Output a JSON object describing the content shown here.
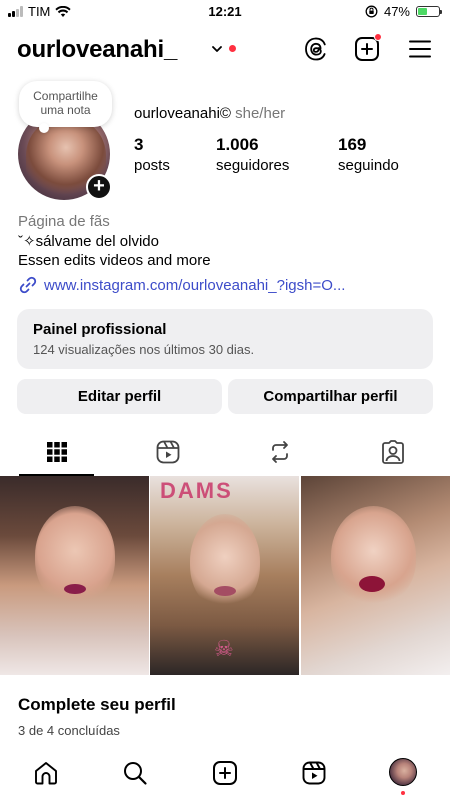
{
  "status_bar": {
    "carrier": "TIM",
    "time": "12:21",
    "battery": "47%",
    "battery_level": 0.47
  },
  "header": {
    "username": "ourloveanahi_",
    "icons": [
      "threads-icon",
      "create-plus-icon",
      "hamburger-menu-icon"
    ]
  },
  "profile": {
    "note_prompt": "Compartilhe uma nota",
    "display_name": "ourloveanahi©",
    "pronouns": "she/her",
    "stats": {
      "posts_value": "3",
      "posts_label": "posts",
      "followers_value": "1.006",
      "followers_label": "seguidores",
      "following_value": "169",
      "following_label": "seguindo"
    },
    "bio": {
      "category": "Página de fãs",
      "line1": "ˇ✧sálvame del olvido",
      "line2": "Essen edits videos and more",
      "link": "www.instagram.com/ourloveanahi_?igsh=O..."
    }
  },
  "pro_panel": {
    "title": "Painel profissional",
    "subtitle": "124 visualizações nos últimos 30 dias."
  },
  "buttons": {
    "edit": "Editar perfil",
    "share": "Compartilhar perfil"
  },
  "tabs": [
    "grid-icon",
    "reels-icon",
    "reposts-icon",
    "tagged-icon"
  ],
  "posts": {
    "post2_overlay": "DAMS"
  },
  "complete_profile": {
    "title": "Complete seu perfil",
    "progress": "3 de 4",
    "progress_suffix": "concluídas"
  },
  "bottom_nav": [
    "home-icon",
    "search-icon",
    "create-icon",
    "reels-icon",
    "profile-avatar"
  ],
  "colors": {
    "accent_red": "#ff3040",
    "link_blue": "#3d4cc9",
    "button_bg": "#efeff1"
  }
}
